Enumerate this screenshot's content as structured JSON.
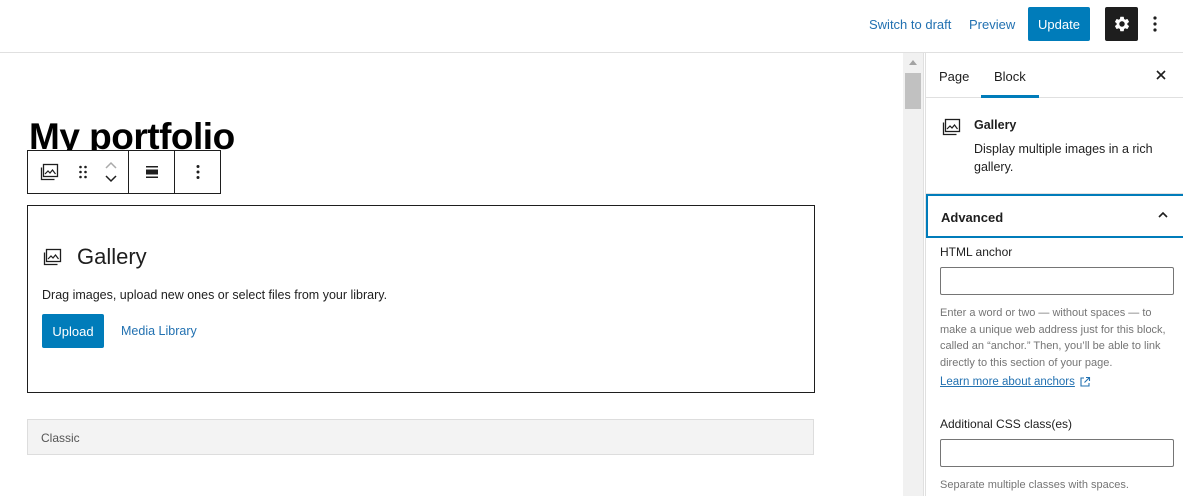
{
  "header": {
    "switch_draft": "Switch to draft",
    "preview": "Preview",
    "update": "Update",
    "settings_icon": "gear-icon",
    "more_icon": "kebab-menu-icon"
  },
  "editor": {
    "page_title": "My portfolio",
    "toolbar_icons": [
      "gallery-icon",
      "drag-handle-icon",
      "move-up-icon",
      "move-down-icon",
      "align-icon",
      "more-options-icon"
    ],
    "gallery_block": {
      "title": "Gallery",
      "instructions": "Drag images, upload new ones or select files from your library.",
      "upload_label": "Upload",
      "media_library_label": "Media Library"
    },
    "classic_block": {
      "label": "Classic"
    }
  },
  "sidebar": {
    "tabs": [
      {
        "label": "Page"
      },
      {
        "label": "Block"
      }
    ],
    "active_tab": "Block",
    "block_card": {
      "name": "Gallery",
      "description": "Display multiple images in a rich gallery."
    },
    "advanced_panel": {
      "label": "Advanced",
      "html_anchor_label": "HTML anchor",
      "html_anchor_value": "",
      "html_anchor_help": "Enter a word or two — without spaces — to make a unique web address just for this block, called an “anchor.” Then, you’ll be able to link directly to this section of your page.",
      "learn_more": "Learn more about anchors",
      "css_class_label": "Additional CSS class(es)",
      "css_class_value": "",
      "css_class_help": "Separate multiple classes with spaces."
    }
  },
  "colors": {
    "accent": "#007cba",
    "link": "#2271b1",
    "dark": "#1e1e1e"
  }
}
